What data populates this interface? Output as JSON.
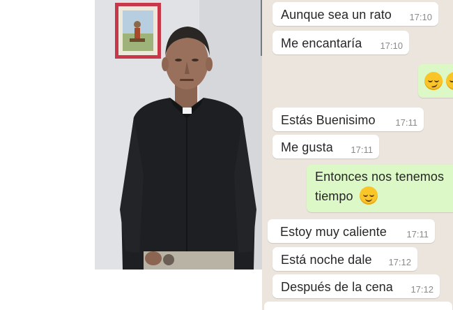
{
  "messages": [
    {
      "text": "Aunque sea un rato",
      "time": "17:10"
    },
    {
      "text": "Me encantaría",
      "time": "17:10"
    },
    {
      "text": "Estás Buenisimo",
      "time": "17:11"
    },
    {
      "text": "Me gusta",
      "time": "17:11"
    },
    {
      "text": "Entonces nos tenemos",
      "line2": "tiempo"
    },
    {
      "text": "Estoy muy caliente",
      "time": "17:11"
    },
    {
      "text": "Está noche dale",
      "time": "17:12"
    },
    {
      "text": "Después de la cena",
      "time": "17:12"
    }
  ],
  "emojis": {
    "smirk": "smirking-face-icon",
    "relieved": "relieved-face-icon"
  },
  "colors": {
    "chat_background": "#ece5dd",
    "incoming_bubble": "#ffffff",
    "outgoing_bubble": "#dcf8c6",
    "timestamp": "#8a8a8a"
  }
}
